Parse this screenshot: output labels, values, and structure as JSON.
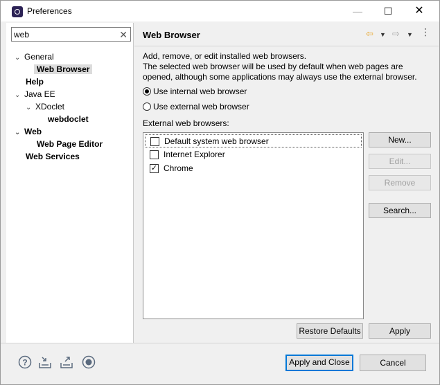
{
  "window": {
    "title": "Preferences",
    "minimize_glyph": "—",
    "maximize_glyph": "☐",
    "close_glyph": "✕"
  },
  "filter": {
    "value": "web",
    "clear_glyph": "✕"
  },
  "tree": [
    {
      "label": "General",
      "expanded": true,
      "bold": false
    },
    {
      "label": "Web Browser",
      "selected": true,
      "bold": true
    },
    {
      "label": "Help",
      "bold": true
    },
    {
      "label": "Java EE",
      "expanded": true,
      "bold": false
    },
    {
      "label": "XDoclet",
      "expanded": true,
      "bold": false
    },
    {
      "label": "webdoclet",
      "bold": true
    },
    {
      "label": "Web",
      "expanded": true,
      "bold": true
    },
    {
      "label": "Web Page Editor",
      "bold": true
    },
    {
      "label": "Web Services",
      "bold": true
    }
  ],
  "page": {
    "title": "Web Browser",
    "description_line1": "Add, remove, or edit installed web browsers.",
    "description_line2": "The selected web browser will be used by default when web pages are",
    "description_line3": "opened, although some applications may always use the external browser.",
    "radio_internal": "Use internal web browser",
    "radio_external": "Use external web browser",
    "selected_radio": "internal",
    "external_label": "External web browsers:",
    "browsers": [
      {
        "label": "Default system web browser",
        "checked": false
      },
      {
        "label": "Internet Explorer",
        "checked": false
      },
      {
        "label": "Chrome",
        "checked": true
      }
    ],
    "buttons": {
      "new": "New...",
      "edit": "Edit...",
      "remove": "Remove",
      "search": "Search...",
      "restore_defaults": "Restore Defaults",
      "apply": "Apply"
    }
  },
  "footer": {
    "apply_and_close": "Apply and Close",
    "cancel": "Cancel"
  },
  "icons": {
    "back": "back-arrow-icon",
    "forward": "forward-arrow-icon",
    "view_menu": "view-menu-icon",
    "help": "help-icon",
    "import": "import-icon",
    "export": "export-icon",
    "record": "record-icon"
  },
  "colors": {
    "back_arrow": "#e8a42a",
    "focus_border": "#0078d7",
    "icon_color": "#5a6a7e"
  }
}
